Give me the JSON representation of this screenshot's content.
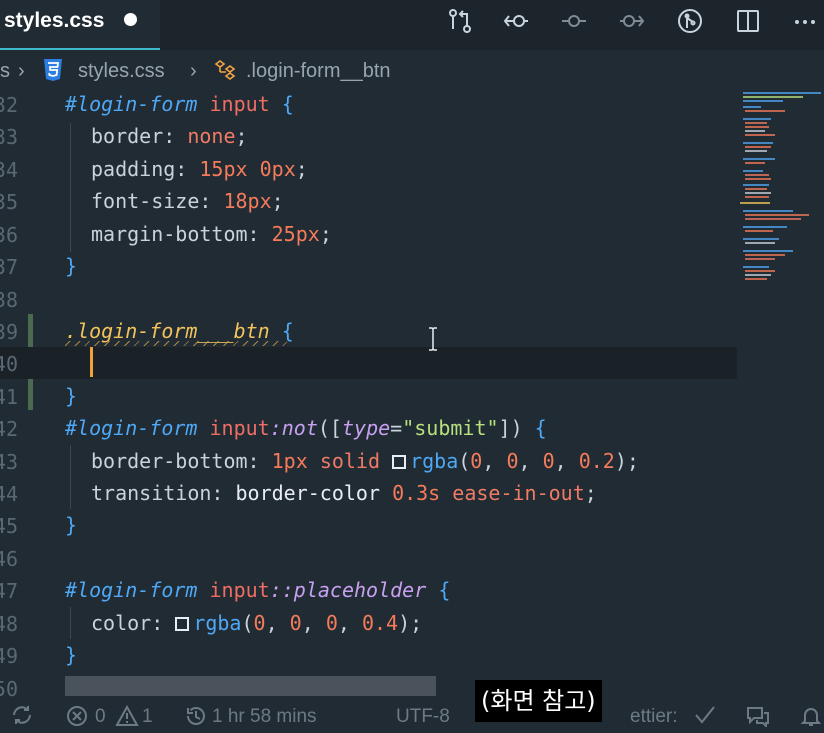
{
  "tab": {
    "title": "styles.css"
  },
  "breadcrumb": {
    "folder": "s",
    "file": "styles.css",
    "symbol": ".login-form__btn"
  },
  "lines": [
    {
      "n": "32"
    },
    {
      "n": "33"
    },
    {
      "n": "34"
    },
    {
      "n": "35"
    },
    {
      "n": "36"
    },
    {
      "n": "37"
    },
    {
      "n": "38"
    },
    {
      "n": "39"
    },
    {
      "n": "40"
    },
    {
      "n": "41"
    },
    {
      "n": "42"
    },
    {
      "n": "43"
    },
    {
      "n": "44"
    },
    {
      "n": "45"
    },
    {
      "n": "46"
    },
    {
      "n": "47"
    },
    {
      "n": "48"
    },
    {
      "n": "49"
    },
    {
      "n": "50"
    }
  ],
  "code": {
    "l32": [
      "#login-form",
      " ",
      "input",
      " ",
      "{"
    ],
    "l33": [
      "border",
      ": ",
      "none",
      ";"
    ],
    "l34": [
      "padding",
      ": ",
      "15px",
      " ",
      "0px",
      ";"
    ],
    "l35": [
      "font-size",
      ": ",
      "18px",
      ";"
    ],
    "l36": [
      "margin-bottom",
      ": ",
      "25px",
      ";"
    ],
    "l37": [
      "}"
    ],
    "l39": [
      ".login-form___btn",
      " ",
      "{"
    ],
    "l41": [
      "}"
    ],
    "l42": [
      "#login-form",
      " ",
      "input",
      ":not",
      "([",
      "type",
      "=",
      "\"submit\"",
      "])",
      " ",
      "{"
    ],
    "l43": [
      "border-bottom",
      ": ",
      "1px",
      " ",
      "solid",
      " ",
      "rgba",
      "(",
      "0",
      ", ",
      "0",
      ", ",
      "0",
      ", ",
      "0.2",
      ");"
    ],
    "l44": [
      "transition",
      ": ",
      "border-color",
      " ",
      "0.3s",
      " ",
      "ease-in-out",
      ";"
    ],
    "l45": [
      "}"
    ],
    "l47": [
      "#login-form",
      " ",
      "input",
      "::placeholder",
      " ",
      "{"
    ],
    "l48": [
      "color",
      ": ",
      "rgba",
      "(",
      "0",
      ", ",
      "0",
      ", ",
      "0",
      ", ",
      "0.4",
      ");"
    ],
    "l49": [
      "}"
    ]
  },
  "status": {
    "errors": "0",
    "warnings": "1",
    "time": "1 hr 58 mins",
    "encoding": "UTF-8",
    "prettier": "ettier:"
  },
  "caption": "(화면 참고)",
  "colors": {
    "accent": "#3fb9c9",
    "caret": "#f0a23a",
    "background": "#212b33"
  }
}
